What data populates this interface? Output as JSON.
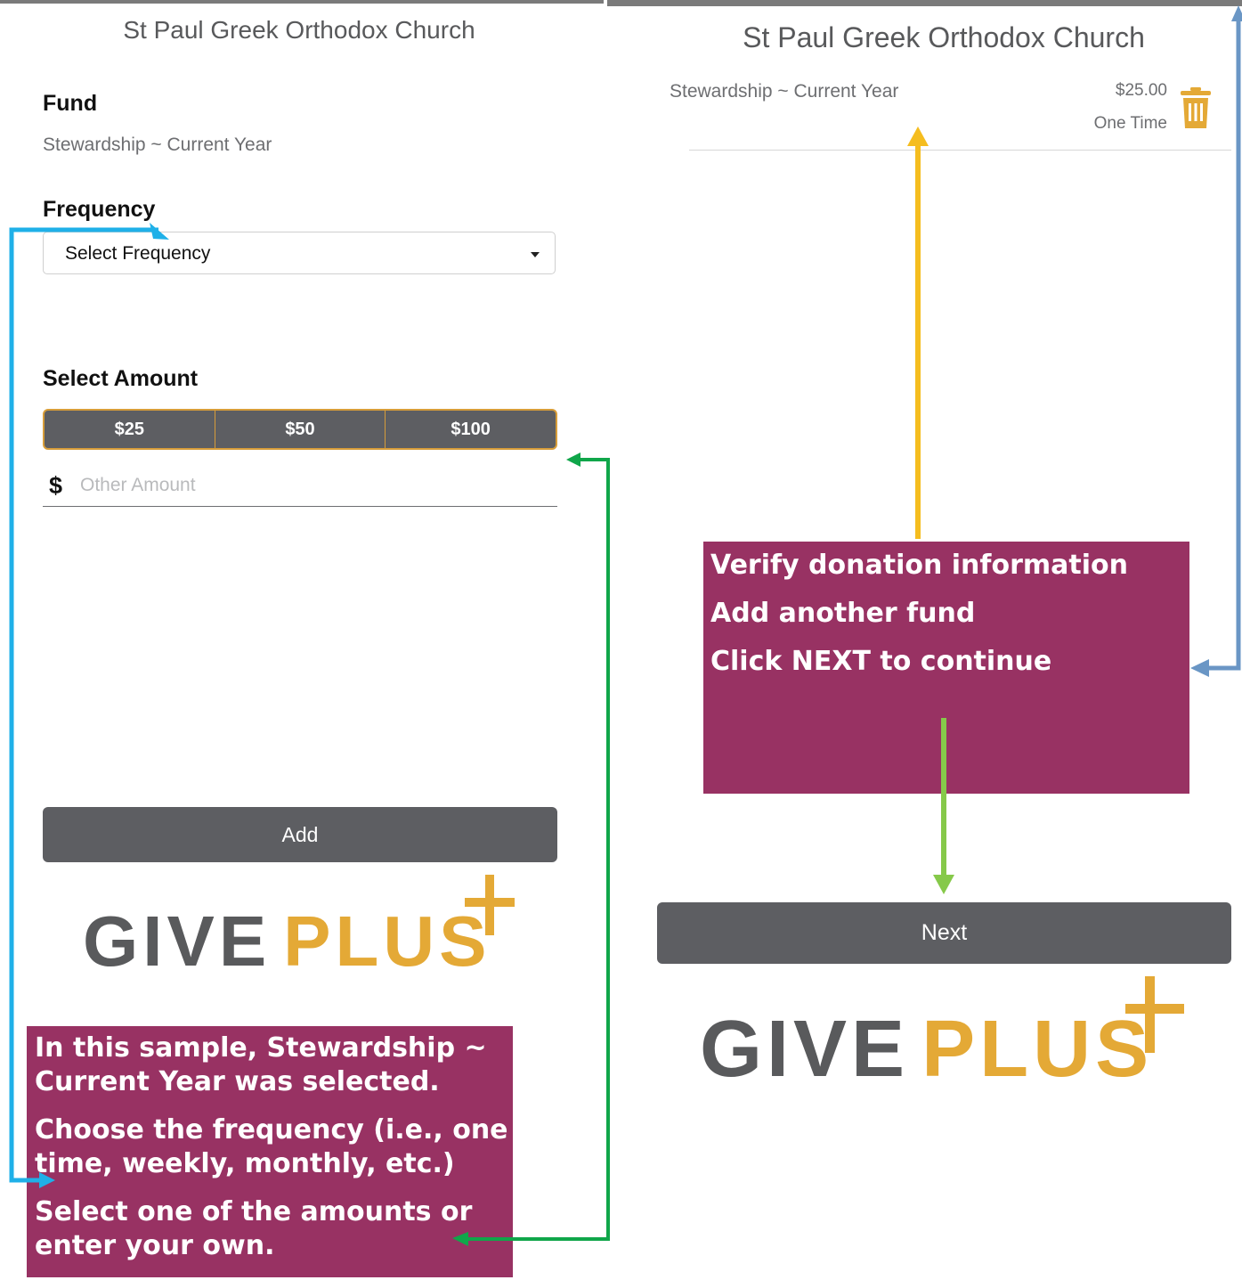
{
  "left_panel": {
    "church_name": "St Paul Greek Orthodox Church",
    "fund": {
      "label": "Fund",
      "value": "Stewardship ~ Current Year"
    },
    "frequency": {
      "label": "Frequency",
      "selected": "Select Frequency"
    },
    "amount": {
      "label": "Select Amount",
      "options": [
        "$25",
        "$50",
        "$100"
      ],
      "other": {
        "symbol": "$",
        "placeholder": "Other Amount"
      }
    },
    "add_label": "Add",
    "logo": {
      "give": "GIVE",
      "plus": "PLUS"
    }
  },
  "right_panel": {
    "church_name": "St Paul Greek Orthodox Church",
    "cart_item": {
      "fund": "Stewardship ~ Current Year",
      "amount": "$25.00",
      "frequency": "One Time",
      "delete_icon": "trash-icon"
    },
    "next_label": "Next",
    "logo": {
      "give": "GIVE",
      "plus": "PLUS"
    }
  },
  "annotations": {
    "left_callout": {
      "line1": "In this sample, Stewardship ~ Current Year was selected.",
      "line2": "Choose the frequency (i.e., one time, weekly, monthly, etc.)",
      "line3": "Select one of the amounts or enter your own."
    },
    "right_callout": {
      "line1": "Verify donation information",
      "line2": "Add another fund",
      "line3": "Click NEXT to continue"
    },
    "colors": {
      "callout_bg": "#983263",
      "arrow_blue": "#1fb0e8",
      "arrow_green": "#10a64a",
      "arrow_yellow": "#f5bd1f",
      "arrow_lightgreen": "#86c94a",
      "arrow_steel": "#6a96c5",
      "brand_gold": "#e4a936",
      "brand_gray": "#595a5c"
    }
  }
}
